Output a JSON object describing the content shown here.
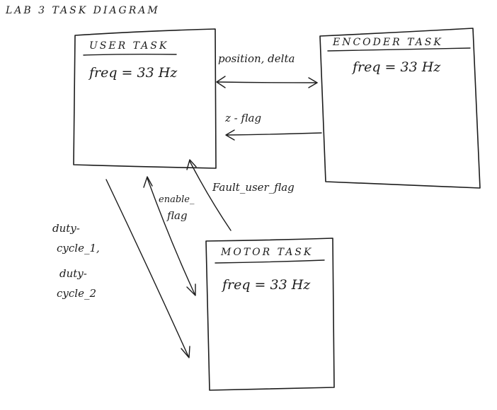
{
  "diagram_title": "LAB 3 TASK DIAGRAM",
  "tasks": {
    "user": {
      "title": "USER TASK",
      "freq": "freq = 33 Hz"
    },
    "encoder": {
      "title": "ENCODER TASK",
      "freq": "freq = 33 Hz"
    },
    "motor": {
      "title": "MOTOR TASK",
      "freq": "freq = 33 Hz"
    }
  },
  "arrows": {
    "position_delta": "position, delta",
    "z_flag": "z - flag",
    "fault_user_flag": "Fault_user_flag",
    "enable_flag_line1": "enable_",
    "enable_flag_line2": "flag",
    "duty_line1": "duty-",
    "duty_line2": "cycle_1,",
    "duty_line3": "duty-",
    "duty_line4": "cycle_2"
  }
}
